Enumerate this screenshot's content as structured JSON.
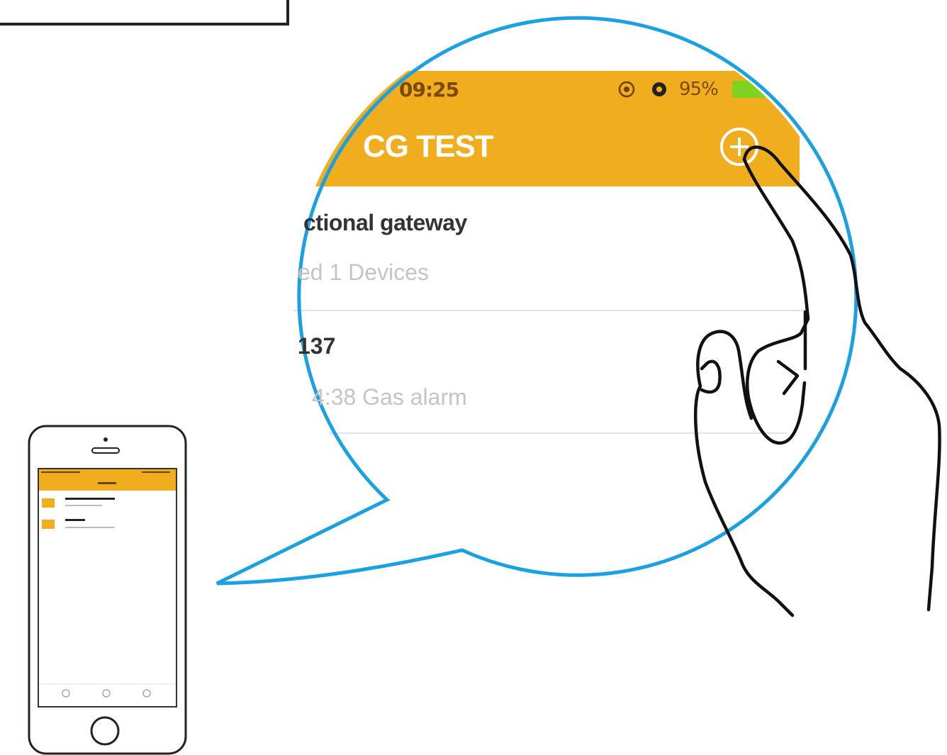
{
  "status_bar": {
    "time": "09:25",
    "battery_percent": "95%",
    "background_color": "#F0AD1E",
    "battery_fill_color": "#7ED321"
  },
  "header": {
    "title": "CG TEST",
    "add_icon": "plus-circle-icon"
  },
  "devices": [
    {
      "title": "ctional gateway",
      "subtitle": "ed 1 Devices"
    },
    {
      "title": "137",
      "subtitle": "4:38  Gas alarm"
    }
  ],
  "colors": {
    "accent": "#F0AD1E",
    "bubble_outline": "#1BA1E2",
    "divider": "#E6E6E6"
  }
}
